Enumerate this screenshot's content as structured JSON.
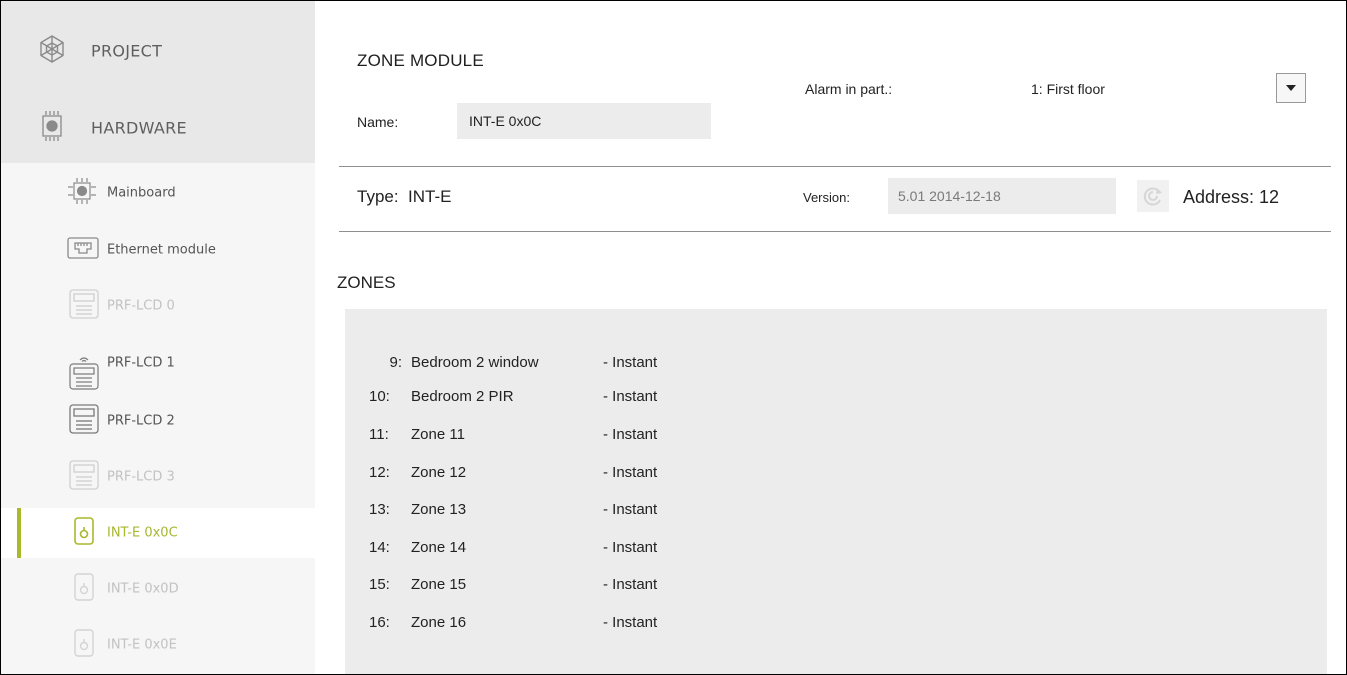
{
  "sidebar": {
    "sections": [
      {
        "label": "PROJECT",
        "icon": "project-icon"
      },
      {
        "label": "HARDWARE",
        "icon": "hardware-chip-icon"
      }
    ],
    "items": [
      {
        "label": "Mainboard",
        "icon": "mainboard-chip-icon",
        "state": "normal"
      },
      {
        "label": "Ethernet module",
        "icon": "ethernet-icon",
        "state": "normal"
      },
      {
        "label": "PRF-LCD 0",
        "icon": "keypad-icon",
        "state": "disabled"
      },
      {
        "label": "PRF-LCD 1",
        "icon": "wireless-keypad-icon",
        "state": "normal"
      },
      {
        "label": "PRF-LCD 2",
        "icon": "keypad-icon",
        "state": "normal"
      },
      {
        "label": "PRF-LCD 3",
        "icon": "keypad-icon",
        "state": "disabled"
      },
      {
        "label": "INT-E 0x0C",
        "icon": "zone-module-icon",
        "state": "active"
      },
      {
        "label": "INT-E 0x0D",
        "icon": "zone-module-icon",
        "state": "disabled"
      },
      {
        "label": "INT-E 0x0E",
        "icon": "zone-module-icon",
        "state": "disabled"
      }
    ]
  },
  "module": {
    "title": "ZONE MODULE",
    "name_label": "Name:",
    "name_value": "INT-E 0x0C",
    "alarm_label": "Alarm in part.:",
    "alarm_value": "1: First floor",
    "type_text": "Type:  INT-E",
    "version_label": "Version:",
    "version_value": "5.01 2014-12-18",
    "address_text": "Address: 12"
  },
  "zones": {
    "title": "ZONES",
    "rows": [
      {
        "num": "9:",
        "name": "Bedroom 2 window",
        "type": "- Instant"
      },
      {
        "num": "10:",
        "name": "Bedroom 2 PIR",
        "type": "- Instant"
      },
      {
        "num": "11:",
        "name": "Zone 11",
        "type": "- Instant"
      },
      {
        "num": "12:",
        "name": "Zone 12",
        "type": "- Instant"
      },
      {
        "num": "13:",
        "name": "Zone 13",
        "type": "- Instant"
      },
      {
        "num": "14:",
        "name": "Zone 14",
        "type": "- Instant"
      },
      {
        "num": "15:",
        "name": "Zone 15",
        "type": "- Instant"
      },
      {
        "num": "16:",
        "name": "Zone 16",
        "type": "- Instant"
      }
    ]
  },
  "colors": {
    "accent": "#a9b92a",
    "sidebar_bg": "#f6f6f6",
    "sidebar_top_bg": "#e8e8e8",
    "panel_bg": "#ececec"
  }
}
